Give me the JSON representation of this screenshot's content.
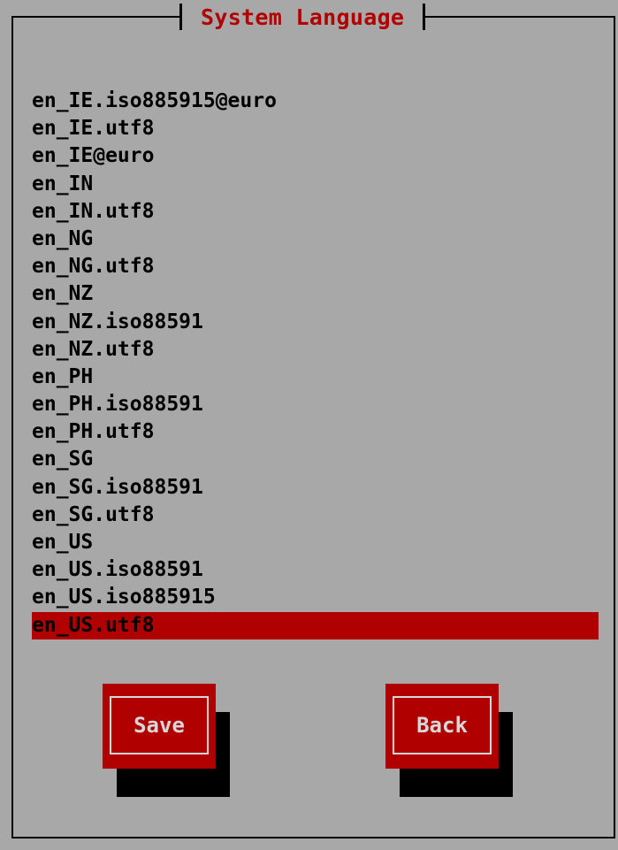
{
  "dialog": {
    "title": "System Language"
  },
  "languages": {
    "items": [
      "en_IE.iso885915@euro",
      "en_IE.utf8",
      "en_IE@euro",
      "en_IN",
      "en_IN.utf8",
      "en_NG",
      "en_NG.utf8",
      "en_NZ",
      "en_NZ.iso88591",
      "en_NZ.utf8",
      "en_PH",
      "en_PH.iso88591",
      "en_PH.utf8",
      "en_SG",
      "en_SG.iso88591",
      "en_SG.utf8",
      "en_US",
      "en_US.iso88591",
      "en_US.iso885915",
      "en_US.utf8"
    ],
    "selected": "en_US.utf8"
  },
  "buttons": {
    "save_label": "Save",
    "back_label": "Back"
  },
  "colors": {
    "background": "#a8a8a8",
    "accent": "#b00000",
    "button_text": "#d8d8d8",
    "shadow": "#000000"
  }
}
